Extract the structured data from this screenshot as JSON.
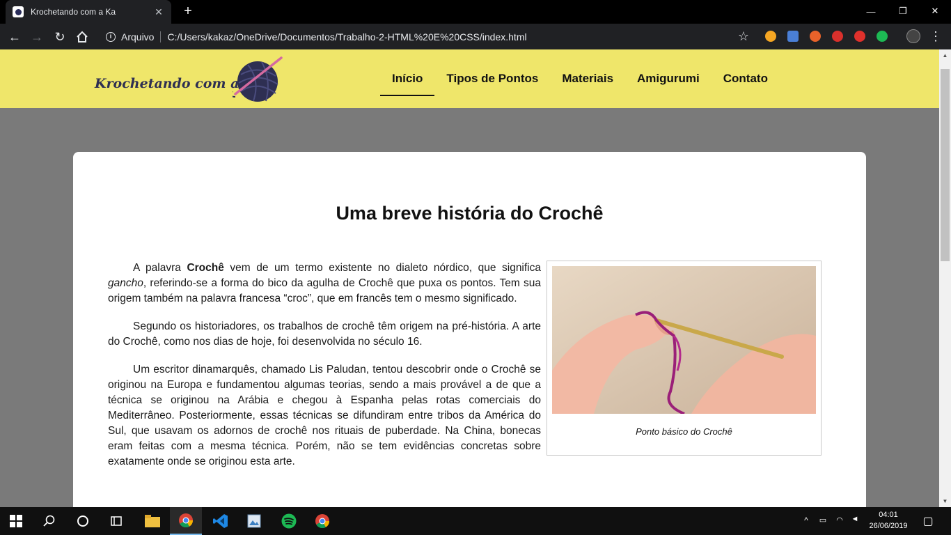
{
  "browser": {
    "tab_title": "Krochetando com a Ka",
    "tab_close": "✕",
    "new_tab": "+",
    "scheme_label": "Arquivo",
    "url": "C:/Users/kakaz/OneDrive/Documentos/Trabalho-2-HTML%20E%20CSS/index.html",
    "minimize": "—",
    "restore": "❐",
    "close": "✕"
  },
  "site": {
    "logo_text": "Krochetando com a Ka",
    "nav": [
      {
        "label": "Início",
        "active": true
      },
      {
        "label": "Tipos de Pontos",
        "active": false
      },
      {
        "label": "Materiais",
        "active": false
      },
      {
        "label": "Amigurumi",
        "active": false
      },
      {
        "label": "Contato",
        "active": false
      }
    ],
    "colors": {
      "header_bg": "#efe66a",
      "page_bg": "#7a7a7a",
      "yarn": "#2e2f52",
      "hook": "#d46aa0"
    }
  },
  "article": {
    "title": "Uma breve história do Crochê",
    "figure_caption": "Ponto básico do Crochê",
    "p1_a": "A palavra ",
    "p1_strong": "Crochê",
    "p1_b": " vem de um termo existente no dialeto nórdico, que significa ",
    "p1_em": "gancho",
    "p1_c": ", referindo-se a forma do bico da agulha de Crochê que puxa os pontos. Tem sua origem também na palavra francesa “croc”, que em francês tem o mesmo significado.",
    "p2": "Segundo os historiadores, os trabalhos de crochê têm origem na pré-história. A arte do Crochê, como nos dias de hoje, foi desenvolvida no século 16.",
    "p3": "Um escritor dinamarquês, chamado Lis Paludan, tentou descobrir onde o Crochê se originou na Europa e fundamentou algumas teorias, sendo a mais provável a de que a técnica se originou na Arábia e chegou à Espanha pelas rotas comerciais do Mediterrâneo. Posteriormente, essas técnicas se difundiram entre tribos da América do Sul, que usavam os adornos de crochê nos rituais de puberdade. Na China, bonecas eram feitas com a mesma técnica. Porém, não se tem evidências concretas sobre exatamente onde se originou esta arte."
  },
  "taskbar": {
    "time": "04:01",
    "date": "26/06/2019",
    "apps": [
      "start-icon",
      "search-icon",
      "cortana-icon",
      "task-view-icon",
      "file-explorer-icon",
      "chrome-icon",
      "vscode-icon",
      "photos-icon",
      "spotify-icon",
      "chrome-icon"
    ]
  }
}
